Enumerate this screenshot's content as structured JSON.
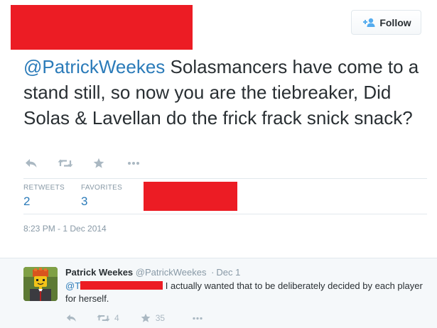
{
  "tweet": {
    "follow_label": "Follow",
    "mention": "@PatrickWeekes",
    "text": " Solasmancers have come to a stand still, so now you are the tiebreaker, Did Solas & Lavellan do the frick frack snick snack?",
    "stats": {
      "retweets_label": "RETWEETS",
      "retweets_value": "2",
      "favorites_label": "FAVORITES",
      "favorites_value": "3"
    },
    "timestamp": "8:23 PM - 1 Dec 2014"
  },
  "reply": {
    "name": "Patrick Weekes",
    "handle": "@PatrickWeekes",
    "separator": "·",
    "date": "Dec 1",
    "mention_prefix": "@T",
    "text": " I actually wanted that to be deliberately decided by each player for herself.",
    "retweet_count": "4",
    "favorite_count": "35"
  },
  "icons": {
    "follow": "add-user-icon",
    "reply": "reply-icon",
    "retweet": "retweet-icon",
    "favorite": "star-icon",
    "more": "more-icon"
  },
  "colors": {
    "link": "#2b7bb9",
    "text": "#292f33",
    "muted": "#8899a6",
    "icon": "#aab8c2",
    "redaction": "#ec1c24",
    "reply_background": "#f5f8fa"
  }
}
